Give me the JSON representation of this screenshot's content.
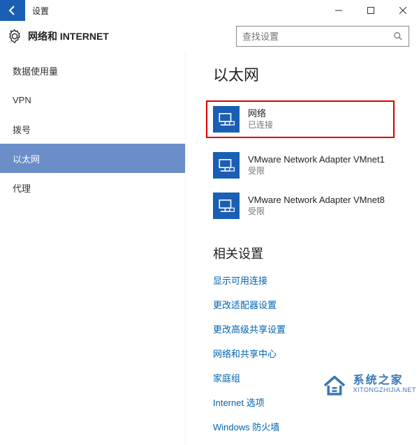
{
  "titlebar": {
    "title": "设置"
  },
  "header": {
    "title": "网络和 INTERNET",
    "search_placeholder": "查找设置"
  },
  "sidebar": {
    "items": [
      {
        "label": "数据使用量"
      },
      {
        "label": "VPN"
      },
      {
        "label": "拨号"
      },
      {
        "label": "以太网"
      },
      {
        "label": "代理"
      }
    ]
  },
  "content": {
    "page_title": "以太网",
    "connections": [
      {
        "name": "网络",
        "status": "已连接"
      },
      {
        "name": "VMware Network Adapter VMnet1",
        "status": "受限"
      },
      {
        "name": "VMware Network Adapter VMnet8",
        "status": "受限"
      }
    ],
    "related_title": "相关设置",
    "related_links": [
      "显示可用连接",
      "更改适配器设置",
      "更改高级共享设置",
      "网络和共享中心",
      "家庭组",
      "Internet 选项",
      "Windows 防火墙"
    ]
  },
  "watermark": {
    "cn": "系统之家",
    "en": "XITONGZHIJIA.NET"
  }
}
